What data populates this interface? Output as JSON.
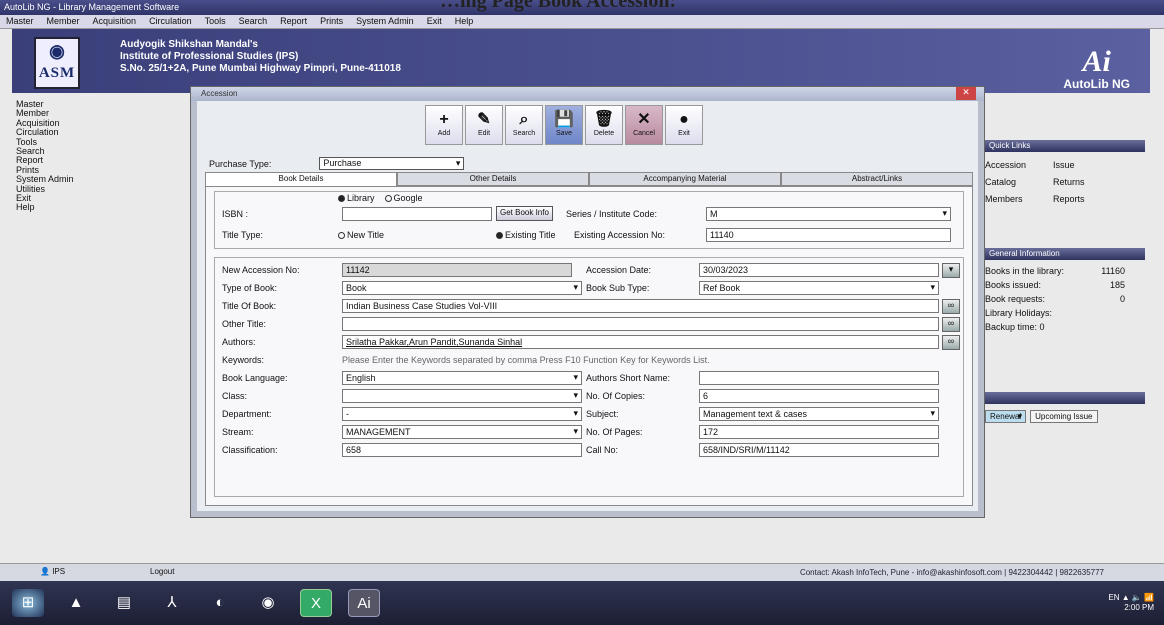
{
  "page_heading": "…ing Page Book Accession:",
  "app": {
    "title": "AutoLib NG - Library Management Software",
    "menu": [
      "Master",
      "Member",
      "Acquisition",
      "Circulation",
      "Tools",
      "Search",
      "Report",
      "Prints",
      "System Admin",
      "Exit",
      "Help"
    ]
  },
  "banner": {
    "logo_text": "ASM",
    "institute": [
      "Audyogik Shikshan Mandal's",
      "Institute of Professional Studies (IPS)",
      "S.No. 25/1+2A, Pune Mumbai Highway Pimpri, Pune-411018"
    ],
    "brand_mark": "Ai",
    "brand_name": "AutoLib NG"
  },
  "sidebar": [
    "Master",
    "Member",
    "Acquisition",
    "Circulation",
    "Tools",
    "Search",
    "Report",
    "Prints",
    "System Admin",
    "Utilities",
    "Exit",
    "Help"
  ],
  "right_panel": {
    "header1": "Quick Links",
    "links": [
      "Accession",
      "Issue",
      "Catalog",
      "Returns",
      "Members",
      "Reports"
    ],
    "header2": "General Information",
    "info": [
      {
        "label": "Books in the library:",
        "value": "11160"
      },
      {
        "label": "Books issued:",
        "value": "185"
      },
      {
        "label": "Book requests:",
        "value": "0"
      },
      {
        "label": "Library Holidays:",
        "value": ""
      },
      {
        "label": "Backup time: 0",
        "value": ""
      }
    ],
    "tabs": [
      "Renewal",
      "Upcoming Issue"
    ]
  },
  "dialog": {
    "title": "Accession",
    "toolbar": [
      {
        "label": "Add",
        "icon": "+"
      },
      {
        "label": "Edit",
        "icon": "✎"
      },
      {
        "label": "Search",
        "icon": "⌕"
      },
      {
        "label": "Save",
        "icon": "💾"
      },
      {
        "label": "Delete",
        "icon": "🗑"
      },
      {
        "label": "Cancel",
        "icon": "✕"
      },
      {
        "label": "Exit",
        "icon": "●"
      }
    ],
    "purchase_type_label": "Purchase Type:",
    "purchase_type_value": "Purchase",
    "tabs": [
      "Book Details",
      "Other Details",
      "Accompanying Material",
      "Abstract/Links"
    ],
    "isbn": {
      "radio_library": "Library",
      "radio_google": "Google",
      "label": "ISBN :",
      "value": "",
      "get_info_button": "Get Book Info",
      "series_label": "Series / Institute Code:",
      "series_value": "M"
    },
    "title_type": {
      "label": "Title Type:",
      "new_title": "New Title",
      "existing_title": "Existing Title",
      "existing_accession_label": "Existing Accession No:",
      "existing_accession_value": "11140"
    },
    "fields": {
      "new_accession_no_label": "New Accession No:",
      "new_accession_no": "11142",
      "accession_date_label": "Accession Date:",
      "accession_date": "30/03/2023",
      "type_of_book_label": "Type of Book:",
      "type_of_book": "Book",
      "book_sub_type_label": "Book Sub Type:",
      "book_sub_type": "Ref Book",
      "title_label": "Title Of Book:",
      "title": "Indian Business Case Studies Vol-VIII",
      "other_title_label": "Other Title:",
      "other_title": "",
      "authors_label": "Authors:",
      "authors": "Srilatha Pakkar,Arun Pandit,Sunanda Sinhal",
      "keywords_label": "Keywords:",
      "keywords_hint": "Please Enter the Keywords separated by comma Press F10 Function Key for Keywords List.",
      "language_label": "Book Language:",
      "language": "English",
      "authors_short_label": "Authors Short Name:",
      "authors_short": "",
      "class_label": "Class:",
      "class": "",
      "copies_label": "No. Of Copies:",
      "copies": "6",
      "department_label": "Department:",
      "department": "-",
      "subject_label": "Subject:",
      "subject": "Management text & cases",
      "stream_label": "Stream:",
      "stream": "MANAGEMENT",
      "pages_label": "No. Of Pages:",
      "pages": "172",
      "classification_label": "Classification:",
      "classification": "658",
      "call_no_label": "Call No:",
      "call_no": "658/IND/SRI/M/11142"
    }
  },
  "status": {
    "user": "IPS",
    "logout": "Logout",
    "contact": "Contact: Akash InfoTech, Pune - info@akashinfosoft.com | 9422304442 | 9822635777"
  },
  "taskbar": {
    "clock_time": "2:00 PM",
    "tray": "EN ▲ 🔈 📶"
  }
}
